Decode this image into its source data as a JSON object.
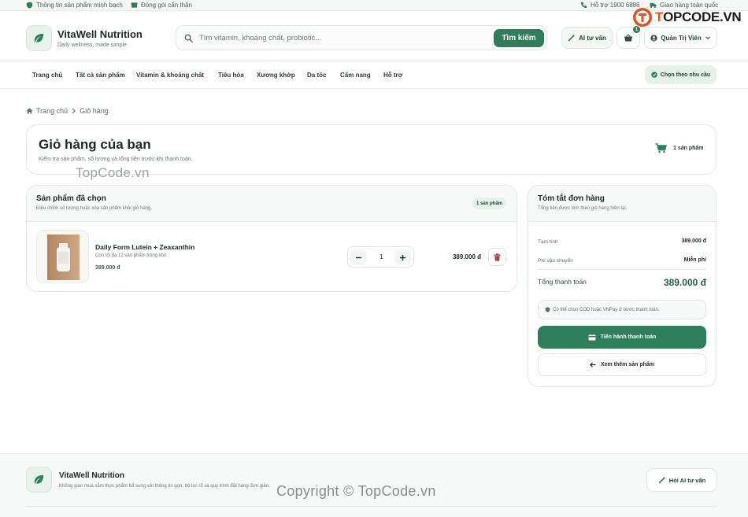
{
  "topbar": {
    "info": "Thông tin sản phẩm minh bạch",
    "packing": "Đóng gói cẩn thận",
    "support": "Hỗ trợ 1900 6886",
    "shipping": "Giao hàng toàn quốc"
  },
  "watermark": {
    "logo_prefix": "T",
    "logo_text": "OPCODE.VN",
    "text_center": "TopCode.vn",
    "copyright": "Copyright © TopCode.vn"
  },
  "brand": {
    "name": "VitaWell Nutrition",
    "tagline": "Daily wellness, made simple"
  },
  "search": {
    "placeholder": "Tìm vitamin, khoáng chất, probiotic...",
    "button": "Tìm kiếm"
  },
  "header_actions": {
    "ai": "AI tư vấn",
    "cart_count": "1",
    "user": "Quản Trị Viên"
  },
  "nav": {
    "items": [
      "Trang chủ",
      "Tất cả sản phẩm",
      "Vitamin & khoáng chất",
      "Tiêu hóa",
      "Xương khớp",
      "Da tóc",
      "Cẩm nang",
      "Hỗ trợ"
    ],
    "choose": "Chọn theo nhu cầu"
  },
  "breadcrumb": {
    "home": "Trang chủ",
    "current": "Giỏ hàng"
  },
  "page": {
    "title": "Giỏ hàng của bạn",
    "subtitle": "Kiểm tra sản phẩm, số lượng và tổng tiền trước khi thanh toán.",
    "count": "1 sản phẩm"
  },
  "products": {
    "title": "Sản phẩm đã chọn",
    "subtitle": "Điều chỉnh số lượng hoặc xóa sản phẩm khỏi giỏ hàng.",
    "badge": "1 sản phẩm",
    "items": [
      {
        "name": "Daily Form Lutein + Zeaxanthin",
        "stock": "Còn tối đa 12 sản phẩm trong kho",
        "price": "389.000 đ",
        "qty": "1",
        "total": "389.000 đ"
      }
    ]
  },
  "summary": {
    "title": "Tóm tắt đơn hàng",
    "subtitle": "Tổng tiền được tính theo giỏ hàng hiện tại.",
    "subtotal_label": "Tạm tính",
    "subtotal": "389.000 đ",
    "shipping_label": "Phí vận chuyển",
    "shipping": "Miễn phí",
    "total_label": "Tổng thanh toán",
    "total": "389.000 đ",
    "note": "Có thể chọn COD hoặc VNPay ở bước thanh toán.",
    "checkout": "Tiến hành thanh toán",
    "more": "Xem thêm sản phẩm"
  },
  "footer": {
    "name": "VitaWell Nutrition",
    "desc": "Không gian mua sắm thực phẩm bổ sung với thông tin gọn, bộ lọc rõ và quy trình đặt hàng đơn giản.",
    "ai": "Hỏi AI tư vấn"
  },
  "colors": {
    "primary": "#2e7d5b",
    "accent_bg": "#e5f1ea",
    "danger": "#a3473c"
  }
}
